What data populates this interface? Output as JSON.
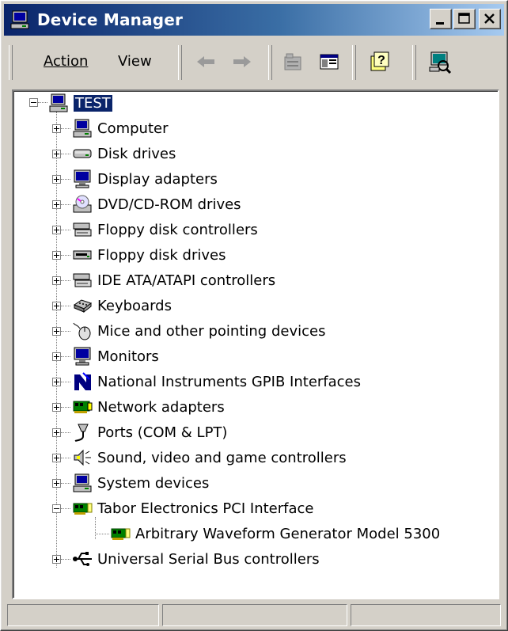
{
  "window": {
    "title": "Device Manager",
    "colors": {
      "titlebar_start": "#0a246a",
      "titlebar_end": "#a6caf0",
      "selection": "#0a246a"
    }
  },
  "toolbar": {
    "action_label": "Action",
    "view_label": "View",
    "icons": [
      "back-arrow-icon",
      "forward-arrow-icon",
      "properties-icon",
      "console-tree-icon",
      "help-icon",
      "scan-hardware-icon"
    ]
  },
  "tree": {
    "root": {
      "label": "TEST",
      "icon": "computer-icon",
      "expanded": true
    },
    "items": [
      {
        "label": "Computer",
        "icon": "computer-icon",
        "expanded": false
      },
      {
        "label": "Disk drives",
        "icon": "disk-drive-icon",
        "expanded": false
      },
      {
        "label": "Display adapters",
        "icon": "display-icon",
        "expanded": false
      },
      {
        "label": "DVD/CD-ROM drives",
        "icon": "cdrom-icon",
        "expanded": false
      },
      {
        "label": "Floppy disk controllers",
        "icon": "controller-icon",
        "expanded": false
      },
      {
        "label": "Floppy disk drives",
        "icon": "floppy-drive-icon",
        "expanded": false
      },
      {
        "label": "IDE ATA/ATAPI controllers",
        "icon": "controller-icon",
        "expanded": false
      },
      {
        "label": "Keyboards",
        "icon": "keyboard-icon",
        "expanded": false
      },
      {
        "label": "Mice and other pointing devices",
        "icon": "mouse-icon",
        "expanded": false
      },
      {
        "label": "Monitors",
        "icon": "monitor-icon",
        "expanded": false
      },
      {
        "label": "National Instruments GPIB Interfaces",
        "icon": "ni-gpib-icon",
        "expanded": false
      },
      {
        "label": "Network adapters",
        "icon": "network-card-icon",
        "expanded": false
      },
      {
        "label": "Ports (COM & LPT)",
        "icon": "port-icon",
        "expanded": false
      },
      {
        "label": "Sound, video and game controllers",
        "icon": "speaker-icon",
        "expanded": false
      },
      {
        "label": "System devices",
        "icon": "computer-icon",
        "expanded": false
      },
      {
        "label": "Tabor Electronics PCI Interface",
        "icon": "pci-card-icon",
        "expanded": true
      },
      {
        "label": "Arbitrary Waveform Generator Model 5300",
        "icon": "pci-card-icon",
        "child": true
      },
      {
        "label": "Universal Serial Bus controllers",
        "icon": "usb-icon",
        "expanded": false
      }
    ]
  },
  "statusbar": {
    "panels": [
      "",
      "",
      ""
    ]
  }
}
